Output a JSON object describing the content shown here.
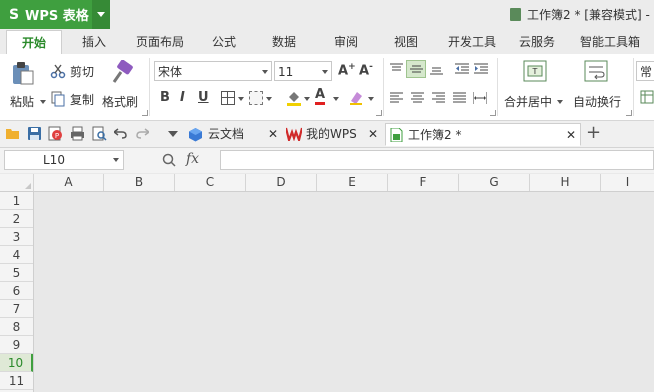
{
  "app": {
    "logo": "S",
    "name": "WPS 表格"
  },
  "window": {
    "title": "工作簿2 * [兼容模式] -"
  },
  "tabs": [
    "开始",
    "插入",
    "页面布局",
    "公式",
    "数据",
    "审阅",
    "视图",
    "开发工具",
    "云服务",
    "智能工具箱"
  ],
  "ribbon": {
    "paste": "粘贴",
    "cut": "剪切",
    "copy": "复制",
    "format_painter": "格式刷",
    "font_name": "宋体",
    "font_size": "11",
    "bold": "B",
    "italic": "I",
    "underline": "U",
    "font_color_glyph": "A",
    "merge_center": "合并居中",
    "wrap_text": "自动换行",
    "number_format": "常"
  },
  "doc_tabs": [
    {
      "label": "云文档"
    },
    {
      "label": "我的WPS"
    },
    {
      "label": "工作簿2 *"
    }
  ],
  "formula_bar": {
    "cell_ref": "L10",
    "fx": "fx",
    "content": ""
  },
  "columns": [
    "A",
    "B",
    "C",
    "D",
    "E",
    "F",
    "G",
    "H",
    "I"
  ],
  "rows": [
    "1",
    "2",
    "3",
    "4",
    "5",
    "6",
    "7",
    "8",
    "9",
    "10",
    "11"
  ],
  "selected_row": "10",
  "colors": {
    "accent": "#3f9f3f",
    "tab_active_text": "#2a8a2a"
  }
}
